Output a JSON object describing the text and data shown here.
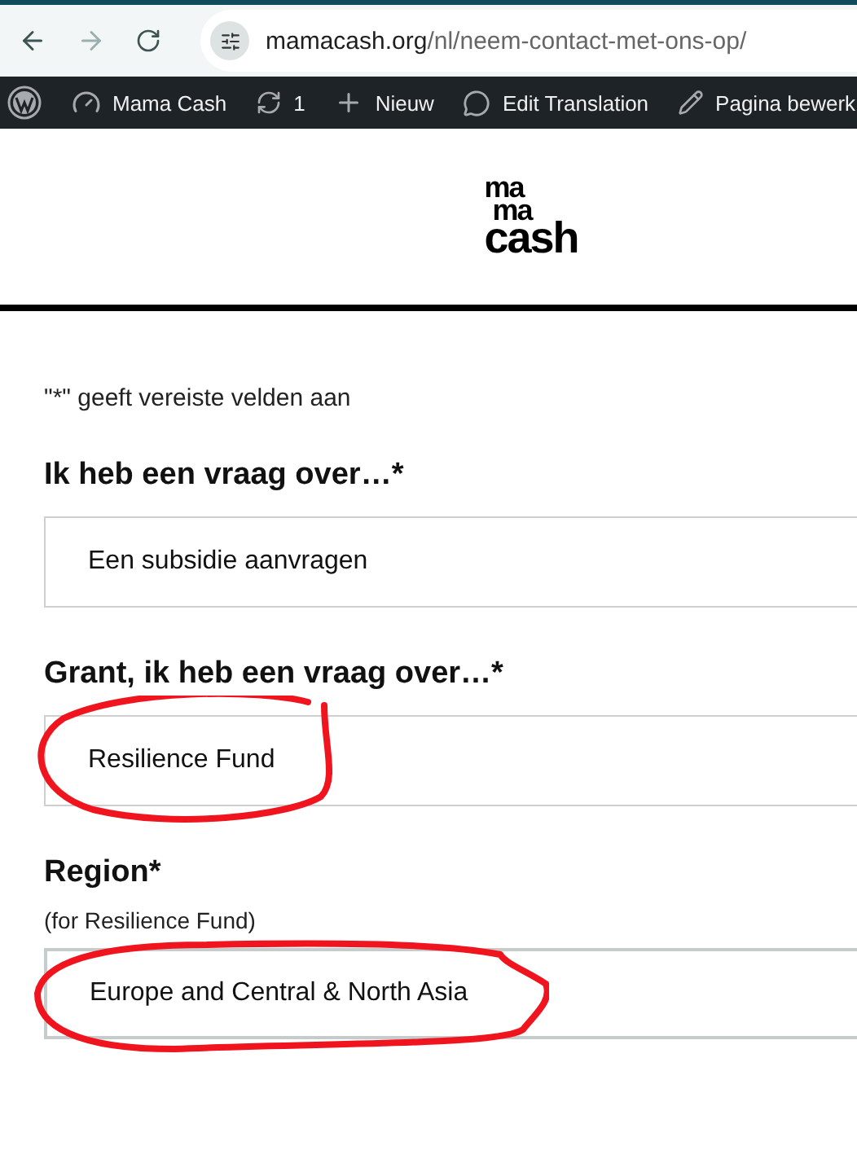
{
  "browser": {
    "url_host": "mamacash.org",
    "url_path": "/nl/neem-contact-met-ons-op/"
  },
  "admin_bar": {
    "items": [
      {
        "kind": "wordpress"
      },
      {
        "kind": "site",
        "label": "Mama Cash"
      },
      {
        "kind": "updates",
        "label": "1"
      },
      {
        "kind": "new",
        "label": "Nieuw"
      },
      {
        "kind": "translate",
        "label": "Edit Translation"
      },
      {
        "kind": "edit",
        "label": "Pagina bewerk"
      }
    ]
  },
  "logo": {
    "lines": [
      "ma",
      "ma",
      "cash"
    ]
  },
  "form": {
    "required_note": "\"*\" geeft vereiste velden aan",
    "fields": [
      {
        "label": "Ik heb een vraag over…*",
        "value": "Een subsidie aanvragen",
        "circled": false,
        "focused": false
      },
      {
        "label": "Grant, ik heb een vraag over…*",
        "value": "Resilience Fund",
        "circled": true,
        "focused": false
      },
      {
        "label": "Region*",
        "note": "(for Resilience Fund)",
        "value": "Europe and Central & North Asia",
        "circled": true,
        "focused": true
      }
    ]
  }
}
